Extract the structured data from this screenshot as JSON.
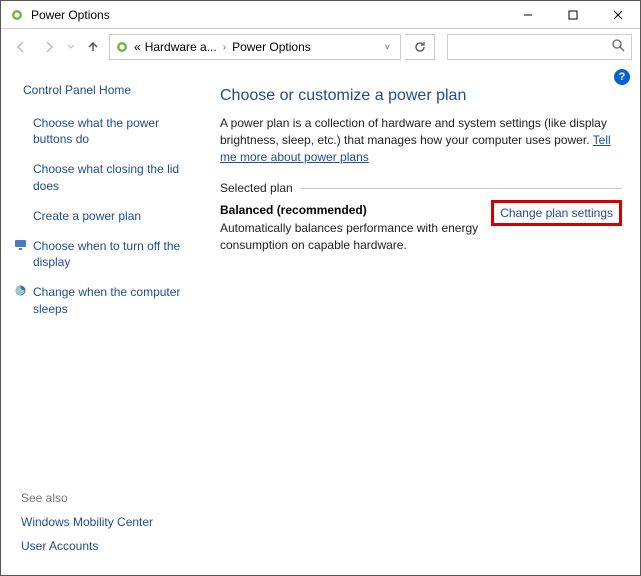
{
  "window": {
    "title": "Power Options"
  },
  "breadcrumb": {
    "ellipsis": "«",
    "parent": "Hardware a...",
    "current": "Power Options"
  },
  "sidebar": {
    "home": "Control Panel Home",
    "links": [
      {
        "label": "Choose what the power buttons do",
        "icon": null
      },
      {
        "label": "Choose what closing the lid does",
        "icon": null
      },
      {
        "label": "Create a power plan",
        "icon": null
      },
      {
        "label": "Choose when to turn off the display",
        "icon": "display"
      },
      {
        "label": "Change when the computer sleeps",
        "icon": "sleep"
      }
    ],
    "see_also_header": "See also",
    "see_also": [
      "Windows Mobility Center",
      "User Accounts"
    ]
  },
  "main": {
    "heading": "Choose or customize a power plan",
    "description": "A power plan is a collection of hardware and system settings (like display brightness, sleep, etc.) that manages how your computer uses power. ",
    "tell_me_more": "Tell me more about power plans",
    "selected_plan_label": "Selected plan",
    "plan": {
      "name": "Balanced (recommended)",
      "description": "Automatically balances performance with energy consumption on capable hardware.",
      "change_link": "Change plan settings"
    }
  },
  "help_glyph": "?"
}
